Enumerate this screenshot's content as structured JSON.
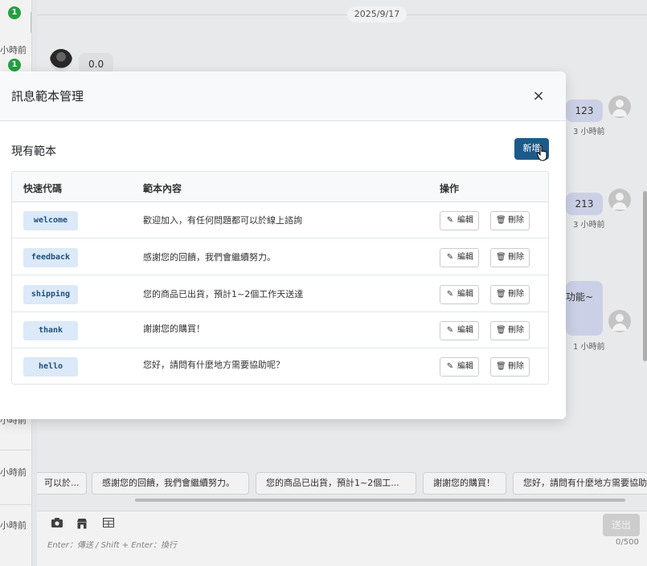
{
  "background": {
    "left_list": {
      "badges": [
        "1",
        "1"
      ],
      "times": [
        "小時前",
        "小時前",
        "小時前",
        "小時前"
      ]
    },
    "chat": {
      "date": "2025/9/17",
      "incoming_message": "0.0",
      "outgoing_messages": [
        {
          "text": "123",
          "time": "3 小時前"
        },
        {
          "text": "213",
          "time": "3 小時前"
        },
        {
          "text": "功能~",
          "time": "1 小時前"
        }
      ]
    },
    "quick_replies": [
      "可以於...",
      "感謝您的回饋，我們會繼續努力。",
      "您的商品已出貨，預計1~2個工...",
      "謝謝您的購買！",
      "您好，請問有什麼地方需要協助"
    ],
    "composer": {
      "send_label": "送出",
      "hint": "Enter：傳送 / Shift + Enter：換行",
      "counter": "0/500"
    }
  },
  "modal": {
    "title": "訊息範本管理",
    "close_label": "×",
    "section_title": "現有範本",
    "add_label": "新增",
    "columns": {
      "code": "快速代碼",
      "content": "範本內容",
      "actions": "操作"
    },
    "edit_label": "編輯",
    "delete_label": "刪除",
    "rows": [
      {
        "code": "welcome",
        "content": "歡迎加入，有任何問題都可以於線上諮詢"
      },
      {
        "code": "feedback",
        "content": "感謝您的回饋，我們會繼續努力。"
      },
      {
        "code": "shipping",
        "content": "您的商品已出貨，預計1~2個工作天送達"
      },
      {
        "code": "thank",
        "content": "謝謝您的購買！"
      },
      {
        "code": "hello",
        "content": "您好，請問有什麼地方需要協助呢？"
      }
    ]
  },
  "icons": {
    "edit": "pencil-icon",
    "delete": "trash-icon",
    "camera": "camera-icon",
    "shop": "shop-icon",
    "table": "table-icon",
    "close": "close-icon"
  },
  "colors": {
    "primary": "#1d5a8a",
    "code_chip_bg": "#dbe9f8",
    "badge": "#28a745",
    "outgoing_bubble": "#d6dcf3"
  }
}
